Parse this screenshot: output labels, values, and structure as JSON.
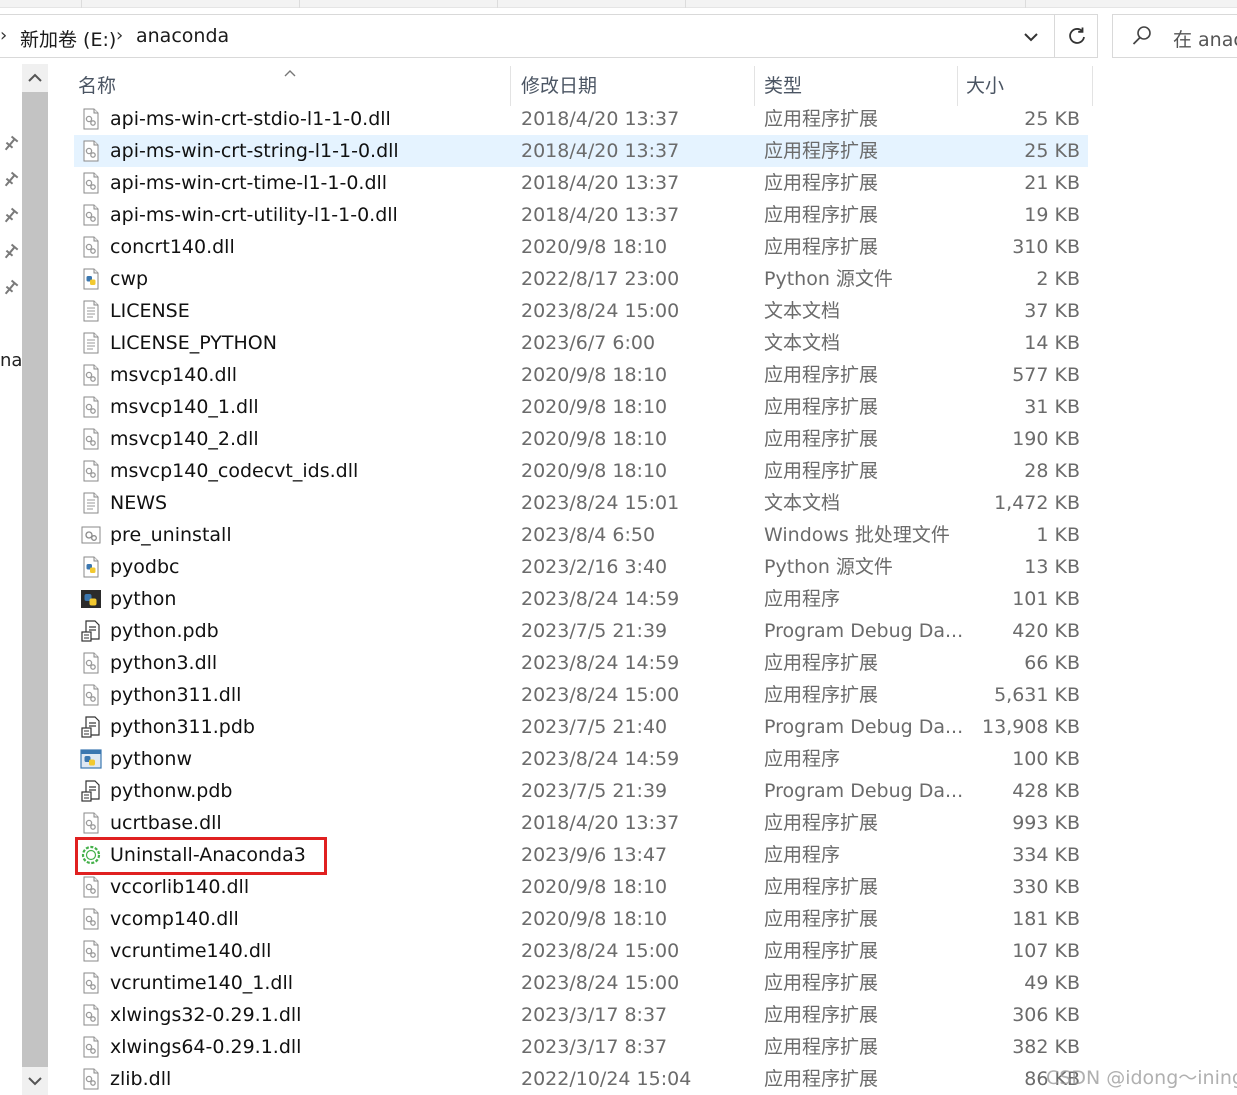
{
  "window": {
    "address": {
      "crumbs": [
        "新加卷 (E:)",
        "anaconda"
      ],
      "search_placeholder": "在 anac"
    },
    "nav_pane_text": "na"
  },
  "columns": {
    "name": "名称",
    "date": "修改日期",
    "type": "类型",
    "size": "大小"
  },
  "files": [
    {
      "name": "api-ms-win-crt-stdio-l1-1-0.dll",
      "date": "2018/4/20 13:37",
      "type": "应用程序扩展",
      "size": "25 KB",
      "icon": "dll-icon"
    },
    {
      "name": "api-ms-win-crt-string-l1-1-0.dll",
      "date": "2018/4/20 13:37",
      "type": "应用程序扩展",
      "size": "25 KB",
      "icon": "dll-icon",
      "selected": true
    },
    {
      "name": "api-ms-win-crt-time-l1-1-0.dll",
      "date": "2018/4/20 13:37",
      "type": "应用程序扩展",
      "size": "21 KB",
      "icon": "dll-icon"
    },
    {
      "name": "api-ms-win-crt-utility-l1-1-0.dll",
      "date": "2018/4/20 13:37",
      "type": "应用程序扩展",
      "size": "19 KB",
      "icon": "dll-icon"
    },
    {
      "name": "concrt140.dll",
      "date": "2020/9/8 18:10",
      "type": "应用程序扩展",
      "size": "310 KB",
      "icon": "dll-icon"
    },
    {
      "name": "cwp",
      "date": "2022/8/17 23:00",
      "type": "Python 源文件",
      "size": "2 KB",
      "icon": "python-file-icon"
    },
    {
      "name": "LICENSE",
      "date": "2023/8/24 15:00",
      "type": "文本文档",
      "size": "37 KB",
      "icon": "text-file-icon"
    },
    {
      "name": "LICENSE_PYTHON",
      "date": "2023/6/7 6:00",
      "type": "文本文档",
      "size": "14 KB",
      "icon": "text-file-icon"
    },
    {
      "name": "msvcp140.dll",
      "date": "2020/9/8 18:10",
      "type": "应用程序扩展",
      "size": "577 KB",
      "icon": "dll-icon"
    },
    {
      "name": "msvcp140_1.dll",
      "date": "2020/9/8 18:10",
      "type": "应用程序扩展",
      "size": "31 KB",
      "icon": "dll-icon"
    },
    {
      "name": "msvcp140_2.dll",
      "date": "2020/9/8 18:10",
      "type": "应用程序扩展",
      "size": "190 KB",
      "icon": "dll-icon"
    },
    {
      "name": "msvcp140_codecvt_ids.dll",
      "date": "2020/9/8 18:10",
      "type": "应用程序扩展",
      "size": "28 KB",
      "icon": "dll-icon"
    },
    {
      "name": "NEWS",
      "date": "2023/8/24 15:01",
      "type": "文本文档",
      "size": "1,472 KB",
      "icon": "text-file-icon"
    },
    {
      "name": "pre_uninstall",
      "date": "2023/8/4 6:50",
      "type": "Windows 批处理文件",
      "size": "1 KB",
      "icon": "batch-file-icon"
    },
    {
      "name": "pyodbc",
      "date": "2023/2/16 3:40",
      "type": "Python 源文件",
      "size": "13 KB",
      "icon": "python-file-icon"
    },
    {
      "name": "python",
      "date": "2023/8/24 14:59",
      "type": "应用程序",
      "size": "101 KB",
      "icon": "python-app-icon"
    },
    {
      "name": "python.pdb",
      "date": "2023/7/5 21:39",
      "type": "Program Debug Da...",
      "size": "420 KB",
      "icon": "pdb-file-icon"
    },
    {
      "name": "python3.dll",
      "date": "2023/8/24 14:59",
      "type": "应用程序扩展",
      "size": "66 KB",
      "icon": "dll-icon"
    },
    {
      "name": "python311.dll",
      "date": "2023/8/24 15:00",
      "type": "应用程序扩展",
      "size": "5,631 KB",
      "icon": "dll-icon"
    },
    {
      "name": "python311.pdb",
      "date": "2023/7/5 21:40",
      "type": "Program Debug Da...",
      "size": "13,908 KB",
      "icon": "pdb-file-icon"
    },
    {
      "name": "pythonw",
      "date": "2023/8/24 14:59",
      "type": "应用程序",
      "size": "100 KB",
      "icon": "pythonw-app-icon"
    },
    {
      "name": "pythonw.pdb",
      "date": "2023/7/5 21:39",
      "type": "Program Debug Da...",
      "size": "428 KB",
      "icon": "pdb-file-icon"
    },
    {
      "name": "ucrtbase.dll",
      "date": "2018/4/20 13:37",
      "type": "应用程序扩展",
      "size": "993 KB",
      "icon": "dll-icon"
    },
    {
      "name": "Uninstall-Anaconda3",
      "date": "2023/9/6 13:47",
      "type": "应用程序",
      "size": "334 KB",
      "icon": "anaconda-icon",
      "highlighted": true
    },
    {
      "name": "vccorlib140.dll",
      "date": "2020/9/8 18:10",
      "type": "应用程序扩展",
      "size": "330 KB",
      "icon": "dll-icon"
    },
    {
      "name": "vcomp140.dll",
      "date": "2020/9/8 18:10",
      "type": "应用程序扩展",
      "size": "181 KB",
      "icon": "dll-icon"
    },
    {
      "name": "vcruntime140.dll",
      "date": "2023/8/24 15:00",
      "type": "应用程序扩展",
      "size": "107 KB",
      "icon": "dll-icon"
    },
    {
      "name": "vcruntime140_1.dll",
      "date": "2023/8/24 15:00",
      "type": "应用程序扩展",
      "size": "49 KB",
      "icon": "dll-icon"
    },
    {
      "name": "xlwings32-0.29.1.dll",
      "date": "2023/3/17 8:37",
      "type": "应用程序扩展",
      "size": "306 KB",
      "icon": "dll-icon"
    },
    {
      "name": "xlwings64-0.29.1.dll",
      "date": "2023/3/17 8:37",
      "type": "应用程序扩展",
      "size": "382 KB",
      "icon": "dll-icon"
    },
    {
      "name": "zlib.dll",
      "date": "2022/10/24 15:04",
      "type": "应用程序扩展",
      "size": "86 KB",
      "icon": "dll-icon"
    }
  ],
  "colors": {
    "selection": "#e5f3ff",
    "highlight_box": "#e02020"
  },
  "watermark": "CSDN @idong～ining"
}
